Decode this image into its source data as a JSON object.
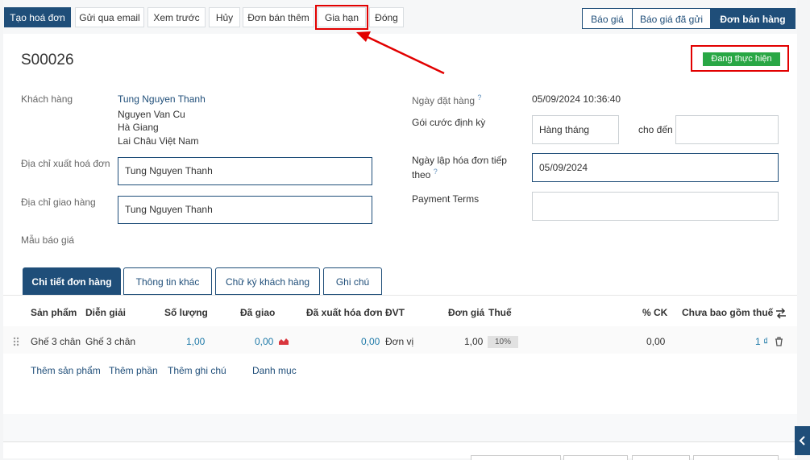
{
  "toolbar": {
    "create_invoice": "Tạo hoá đơn",
    "send_email": "Gửi qua email",
    "preview": "Xem trước",
    "cancel": "Hủy",
    "upsell": "Đơn bán thêm",
    "renew": "Gia hạn",
    "close": "Đóng"
  },
  "stages": [
    "Báo giá",
    "Báo giá đã gửi",
    "Đơn bán hàng"
  ],
  "order": {
    "name": "S00026",
    "status": "Đang thực hiện"
  },
  "customer": {
    "label": "Khách hàng",
    "name": "Tung Nguyen Thanh",
    "address_line1": "Nguyen Van Cu",
    "address_line2": "Hà Giang",
    "address_line3": "Lai Châu Việt Nam"
  },
  "invoice_address": {
    "label": "Địa chỉ xuất hoá đơn",
    "value": "Tung Nguyen Thanh"
  },
  "delivery_address": {
    "label": "Địa chỉ giao hàng",
    "value": "Tung Nguyen Thanh"
  },
  "quote_template": {
    "label": "Mẫu báo giá"
  },
  "order_date": {
    "label": "Ngày đặt hàng",
    "help": "?",
    "value": "05/09/2024 10:36:40"
  },
  "recurring_plan": {
    "label": "Gói cước định kỳ",
    "value": "Hàng tháng",
    "until_label": "cho đến"
  },
  "next_invoice": {
    "label_line1": "Ngày lập hóa đơn tiếp",
    "label_line2": "theo",
    "help": "?",
    "value": "05/09/2024"
  },
  "payment_terms": {
    "label": "Payment Terms"
  },
  "tabs": [
    "Chi tiết đơn hàng",
    "Thông tin khác",
    "Chữ ký khách hàng",
    "Ghi chú"
  ],
  "table": {
    "headers": {
      "product": "Sản phẩm",
      "description": "Diễn giải",
      "quantity": "Số lượng",
      "delivered": "Đã giao",
      "invoiced": "Đã xuất hóa đơn",
      "uom": "ĐVT",
      "unit_price": "Đơn giá",
      "tax": "Thuế",
      "discount": "% CK",
      "subtotal": "Chưa bao gồm thuế"
    },
    "rows": [
      {
        "product": "Ghế 3 chân",
        "description": "Ghế 3 chân",
        "quantity": "1,00",
        "delivered": "0,00",
        "invoiced": "0,00",
        "uom": "Đơn vị",
        "unit_price": "1,00",
        "tax": "10%",
        "discount": "0,00",
        "subtotal": "1 ₫"
      }
    ],
    "add_links": [
      "Thêm sản phẩm",
      "Thêm phần",
      "Thêm ghi chú",
      "Danh mục"
    ]
  },
  "icons": {
    "drag_handle": "drag-handle-icon",
    "forecast": "forecast-chart-icon",
    "delete": "trash-icon",
    "column_settings": "column-settings-icon",
    "side_panel": "chevron-left-icon"
  },
  "colors": {
    "primary": "#1f4e79",
    "status_green": "#29a745",
    "annotation_red": "#e20000",
    "forecast_red": "#d9363e"
  }
}
